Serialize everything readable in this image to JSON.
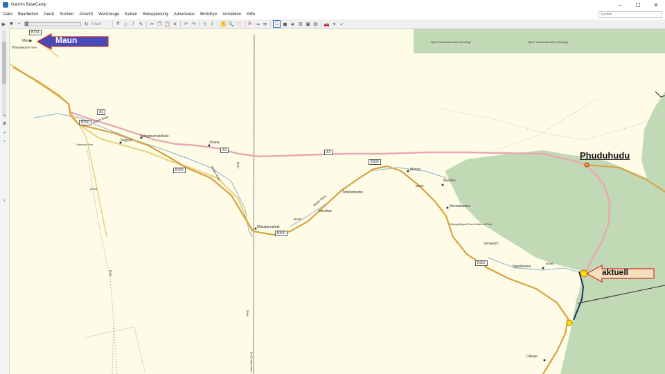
{
  "window": {
    "title": "Garmin BaseCamp",
    "controls": [
      "─",
      "☐",
      "✕"
    ]
  },
  "menu": [
    "Datei",
    "Bearbeiten",
    "Gerät",
    "Suchen",
    "Ansicht",
    "Werkzeuge",
    "Karten",
    "Reiseplanung",
    "Adventures",
    "BirdsEye",
    "Anmelden",
    "Hilfe"
  ],
  "search": {
    "placeholder": "Suchen"
  },
  "toolbar": {
    "zoom_label": "5-fach"
  },
  "map": {
    "towns": [
      "Maun",
      "Tsibogolamatebele",
      "Segoro",
      "Xhana",
      "Sankuyo Pan",
      "Motopi",
      "Makalamabedi",
      "Tsheteshamo",
      "Dorokae",
      "Mawmo",
      "Menoakwena",
      "Senagom",
      "Ngamlisane",
      "Dilwalo"
    ],
    "areas": [
      "Ng/47 Concessionarea (hunting)",
      "Ng/47 Concessionarea (hunting)",
      "Makgadikgadi Pans National Park"
    ],
    "rivers": [
      "Thamalakane river",
      "Boteti River",
      "Boteti River",
      "Boteti",
      "Boteti",
      "Boteti",
      "Boteti River"
    ],
    "roads": [
      "B334",
      "A3",
      "A3",
      "A3",
      "B300",
      "B300",
      "B300",
      "B300",
      "B300",
      "[4wd]",
      "[4wd]",
      "[4wd]",
      "[4wd]",
      "Sand Main [4x4]"
    ],
    "annotations": {
      "maun": "Maun",
      "phuduhudu": "Phuduhudu",
      "aktuell": "aktuell"
    }
  }
}
